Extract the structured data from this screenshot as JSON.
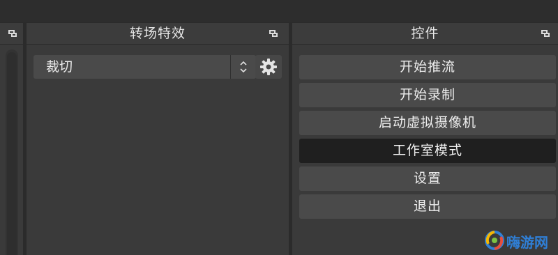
{
  "docks": {
    "transitions": {
      "title": "转场特效",
      "selected_transition": "裁切"
    },
    "controls": {
      "title": "控件",
      "buttons": [
        {
          "label": "开始推流",
          "active": false
        },
        {
          "label": "开始录制",
          "active": false
        },
        {
          "label": "启动虚拟摄像机",
          "active": false
        },
        {
          "label": "工作室模式",
          "active": true
        },
        {
          "label": "设置",
          "active": false
        },
        {
          "label": "退出",
          "active": false
        }
      ]
    }
  },
  "icons": {
    "float": "float-dock-icon",
    "gear": "gear-icon",
    "combo_arrows": "chevron-up-down-icon"
  },
  "watermark": {
    "text": "嗨游网"
  },
  "colors": {
    "background": "#2b2b2b",
    "dock": "#3a3a3a",
    "button": "#4a4a4a",
    "button_active": "#1f1f1f",
    "watermark": "#2f7fd6"
  }
}
